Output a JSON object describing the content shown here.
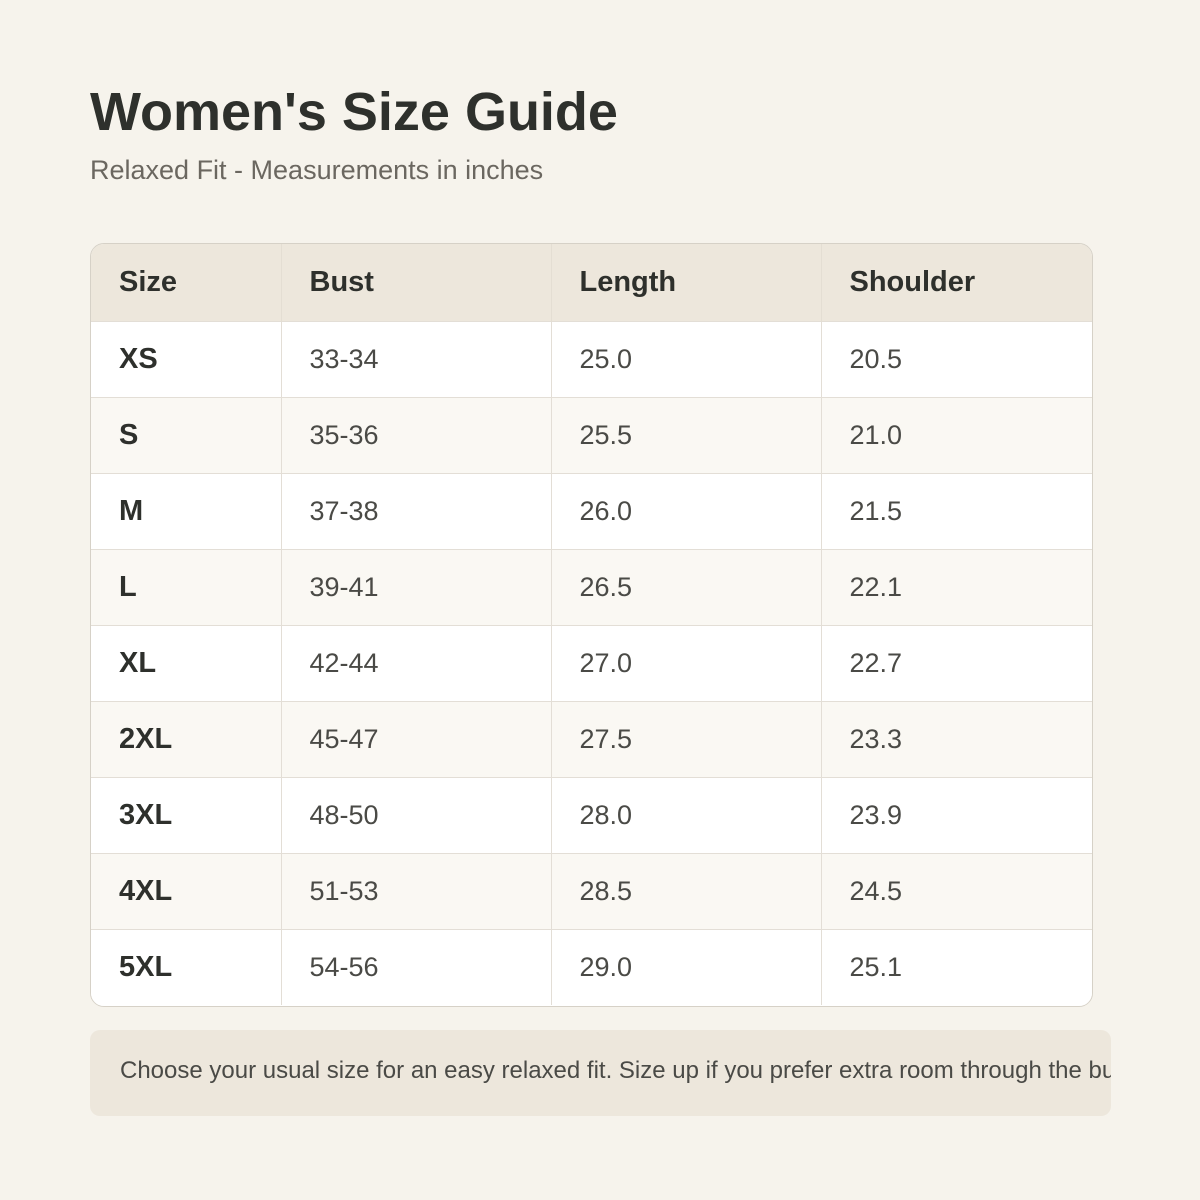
{
  "header": {
    "title": "Women's Size Guide",
    "subtitle": "Relaxed Fit - Measurements in inches"
  },
  "table": {
    "columns": [
      "Size",
      "Bust",
      "Length",
      "Shoulder"
    ],
    "rows": [
      {
        "size": "XS",
        "bust": "33-34",
        "length": "25.0",
        "shoulder": "20.5"
      },
      {
        "size": "S",
        "bust": "35-36",
        "length": "25.5",
        "shoulder": "21.0"
      },
      {
        "size": "M",
        "bust": "37-38",
        "length": "26.0",
        "shoulder": "21.5"
      },
      {
        "size": "L",
        "bust": "39-41",
        "length": "26.5",
        "shoulder": "22.1"
      },
      {
        "size": "XL",
        "bust": "42-44",
        "length": "27.0",
        "shoulder": "22.7"
      },
      {
        "size": "2XL",
        "bust": "45-47",
        "length": "27.5",
        "shoulder": "23.3"
      },
      {
        "size": "3XL",
        "bust": "48-50",
        "length": "28.0",
        "shoulder": "23.9"
      },
      {
        "size": "4XL",
        "bust": "51-53",
        "length": "28.5",
        "shoulder": "24.5"
      },
      {
        "size": "5XL",
        "bust": "54-56",
        "length": "29.0",
        "shoulder": "25.1"
      }
    ]
  },
  "note": {
    "text": "Choose your usual size for an easy relaxed fit. Size up if you prefer extra room through the bust and ar"
  },
  "colors": {
    "background": "#f6f3ec",
    "header_row": "#ede7dc",
    "title_text": "#2e302c",
    "subtitle_text": "#6b6760"
  }
}
